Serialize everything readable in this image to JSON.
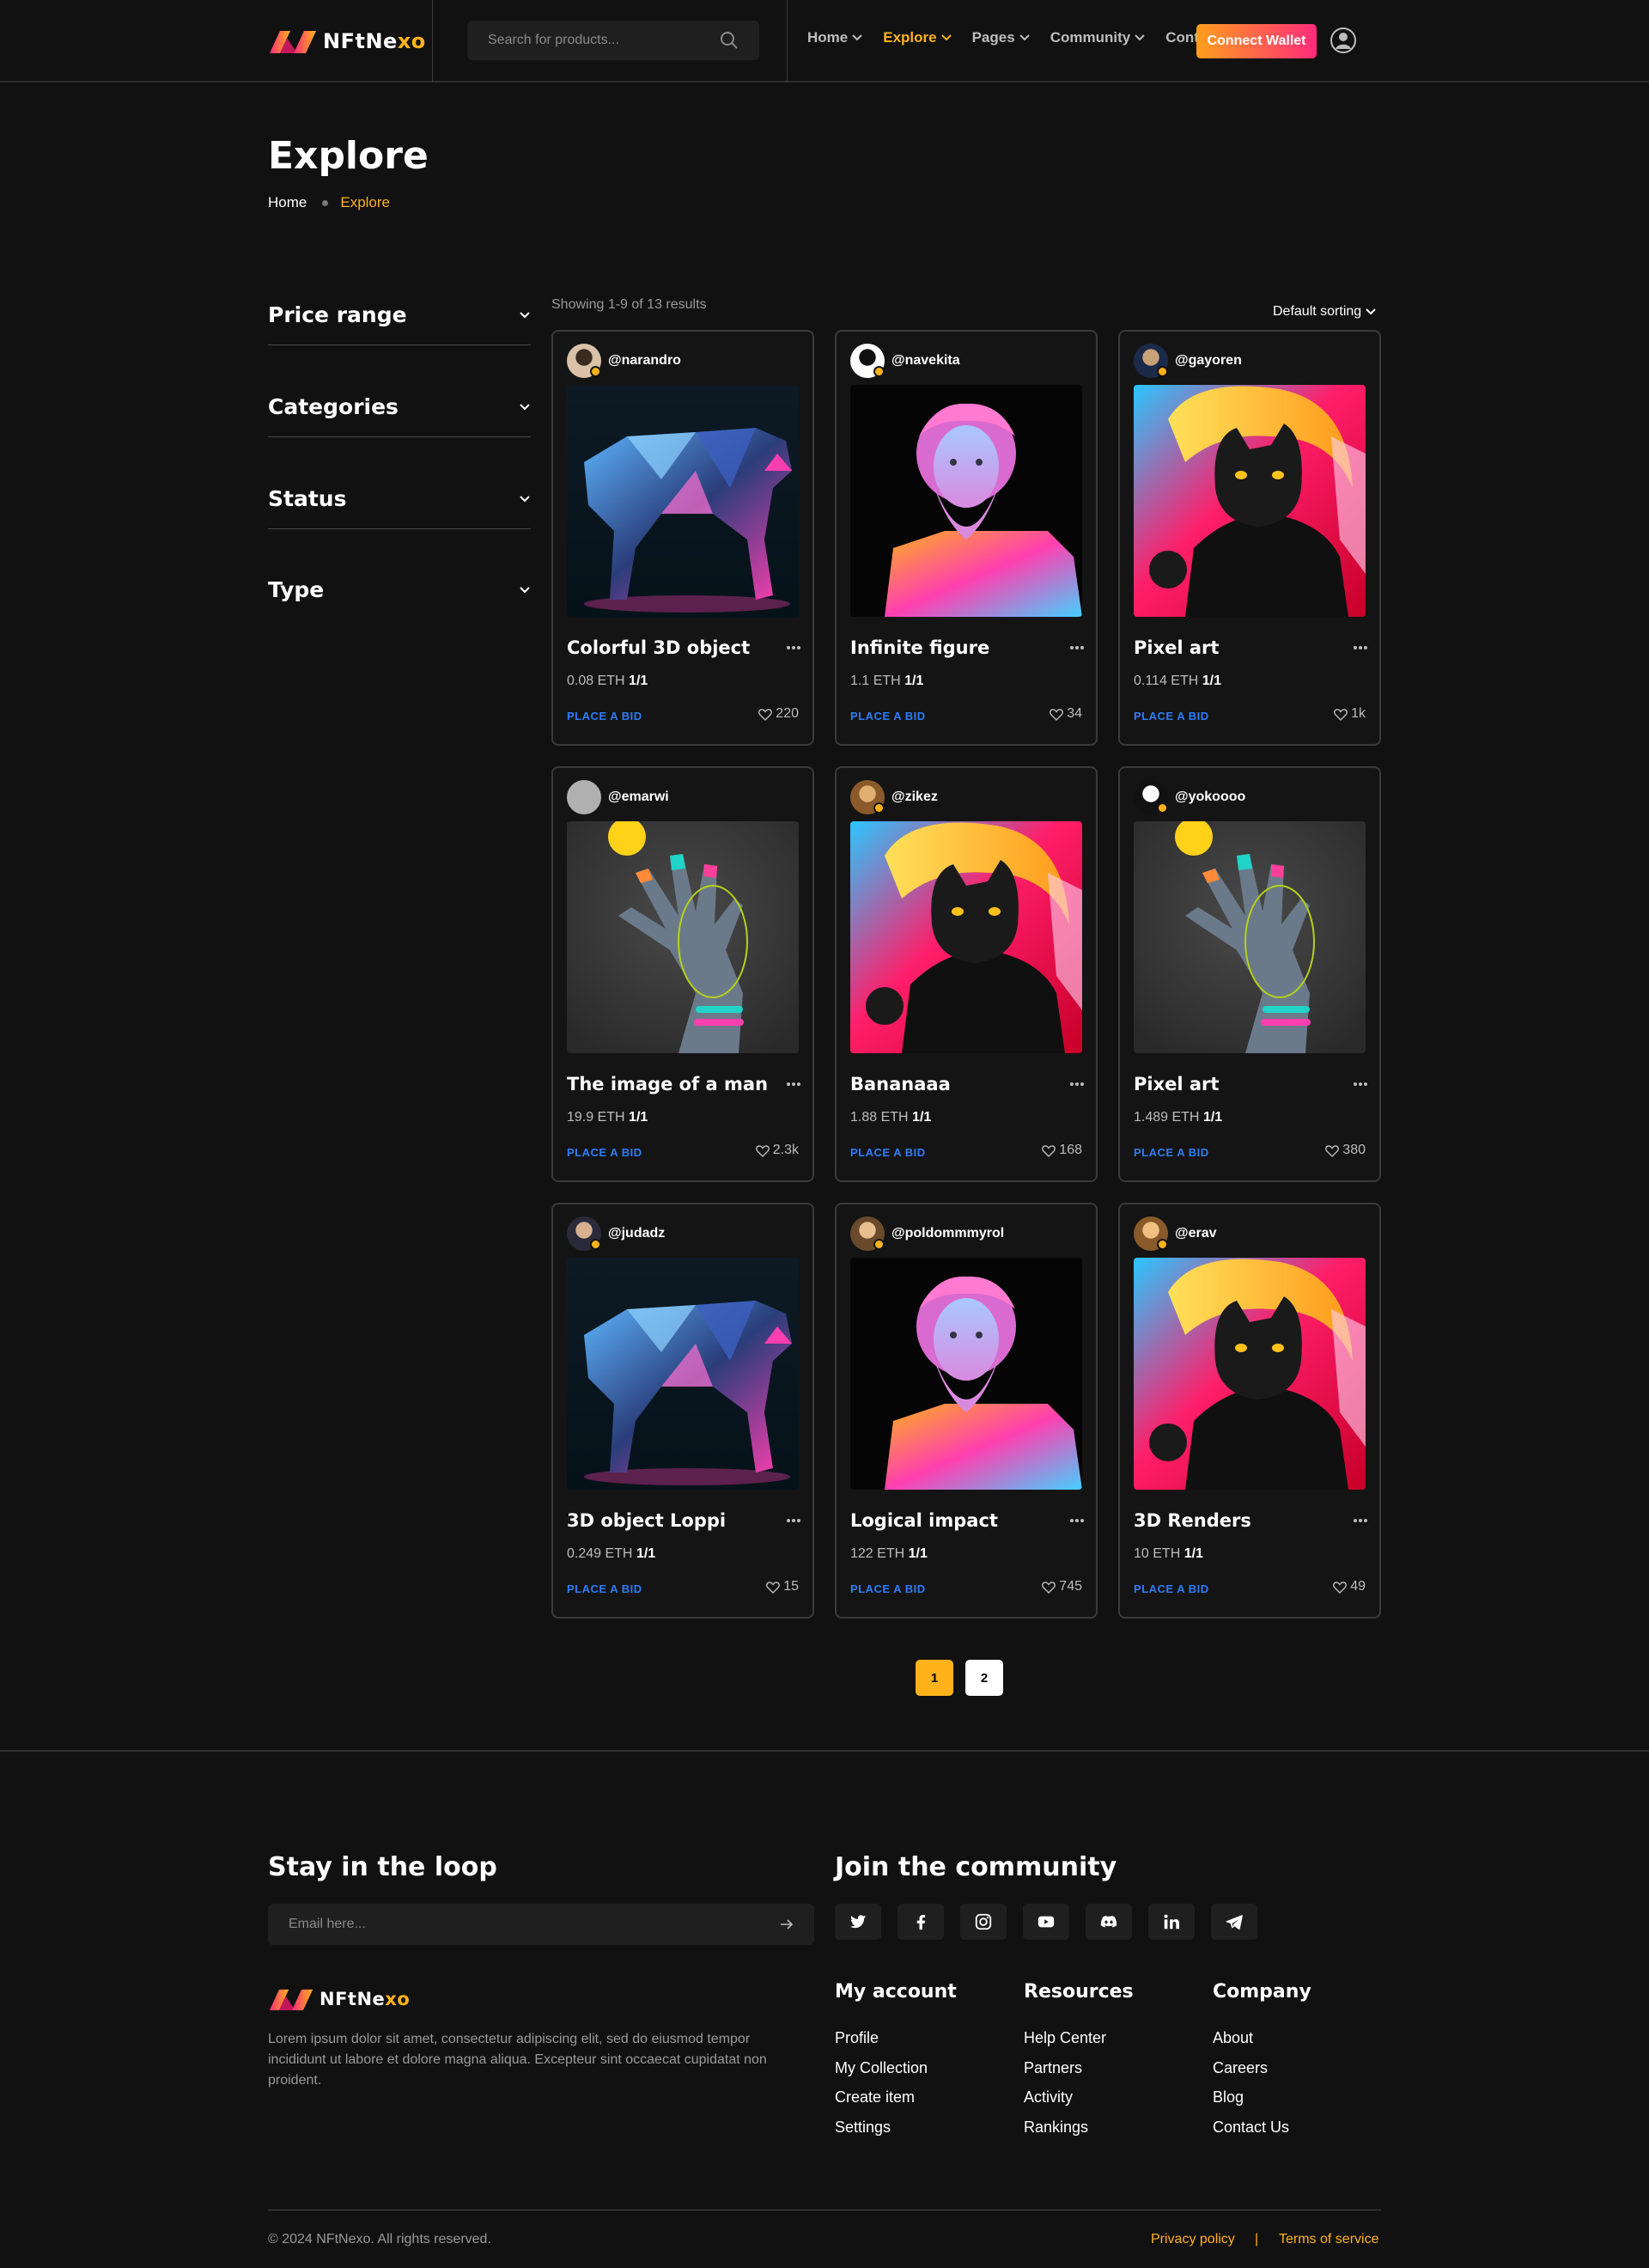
{
  "brand": {
    "part1": "NFt",
    "part2": "Ne",
    "part3": "xo",
    "accent_color": "#ffb21a",
    "gradient": [
      "#ff9f1c",
      "#ff2b7a"
    ]
  },
  "search": {
    "placeholder": "Search for products..."
  },
  "nav": {
    "items": [
      {
        "label": "Home",
        "dropdown": true,
        "active": false
      },
      {
        "label": "Explore",
        "dropdown": true,
        "active": true
      },
      {
        "label": "Pages",
        "dropdown": true,
        "active": false
      },
      {
        "label": "Community",
        "dropdown": true,
        "active": false
      },
      {
        "label": "Contact",
        "dropdown": false,
        "active": false
      }
    ],
    "connect_label": "Connect Wallet"
  },
  "page": {
    "title": "Explore",
    "breadcrumb": [
      "Home",
      "Explore"
    ]
  },
  "filters": [
    "Price range",
    "Categories",
    "Status",
    "Type"
  ],
  "results": {
    "summary": "Showing 1-9 of 13 results",
    "sorting": "Default sorting"
  },
  "cards": [
    {
      "handle": "@narandro",
      "name": "Colorful 3D object",
      "price": "0.08 ETH",
      "edition": "1/1",
      "bid": "PLACE A BID",
      "likes": "220",
      "art": "panther"
    },
    {
      "handle": "@navekita",
      "name": "Infinite figure",
      "price": "1.1 ETH",
      "edition": "1/1",
      "bid": "PLACE A BID",
      "likes": "34",
      "art": "statue"
    },
    {
      "handle": "@gayoren",
      "name": "Pixel art",
      "price": "0.114 ETH",
      "edition": "1/1",
      "bid": "PLACE A BID",
      "likes": "1k",
      "art": "cat"
    },
    {
      "handle": "@emarwi",
      "name": "The image of a man",
      "price": "19.9 ETH",
      "edition": "1/1",
      "bid": "PLACE A BID",
      "likes": "2.3k",
      "art": "hand"
    },
    {
      "handle": "@zikez",
      "name": "Bananaaa",
      "price": "1.88 ETH",
      "edition": "1/1",
      "bid": "PLACE A BID",
      "likes": "168",
      "art": "cat"
    },
    {
      "handle": "@yokoooo",
      "name": "Pixel art",
      "price": "1.489 ETH",
      "edition": "1/1",
      "bid": "PLACE A BID",
      "likes": "380",
      "art": "hand"
    },
    {
      "handle": "@judadz",
      "name": "3D object Loppi",
      "price": "0.249 ETH",
      "edition": "1/1",
      "bid": "PLACE A BID",
      "likes": "15",
      "art": "panther"
    },
    {
      "handle": "@poldommmyrol",
      "name": "Logical impact",
      "price": "122 ETH",
      "edition": "1/1",
      "bid": "PLACE A BID",
      "likes": "745",
      "art": "statue"
    },
    {
      "handle": "@erav",
      "name": "3D Renders",
      "price": "10 ETH",
      "edition": "1/1",
      "bid": "PLACE A BID",
      "likes": "49",
      "art": "cat"
    }
  ],
  "pagination": {
    "pages": [
      "1",
      "2"
    ],
    "current": "1"
  },
  "footer": {
    "newsletter_title": "Stay in the loop",
    "email_placeholder": "Email here...",
    "community_title": "Join the community",
    "socials": [
      "twitter-icon",
      "facebook-icon",
      "instagram-icon",
      "youtube-icon",
      "discord-icon",
      "linkedin-icon",
      "telegram-icon"
    ],
    "about": "Lorem ipsum dolor sit amet, consectetur adipiscing elit, sed do eiusmod tempor incididunt ut labore et dolore magna aliqua. Excepteur sint occaecat cupidatat non proident.",
    "columns": [
      {
        "title": "My account",
        "links": [
          "Profile",
          "My Collection",
          "Create item",
          "Settings"
        ]
      },
      {
        "title": "Resources",
        "links": [
          "Help Center",
          "Partners",
          "Activity",
          "Rankings"
        ]
      },
      {
        "title": "Company",
        "links": [
          "About",
          "Careers",
          "Blog",
          "Contact Us"
        ]
      }
    ],
    "copyright": "© 2024 NFtNexo. All rights reserved.",
    "privacy": "Privacy policy",
    "separator": "|",
    "terms": "Terms of service"
  }
}
